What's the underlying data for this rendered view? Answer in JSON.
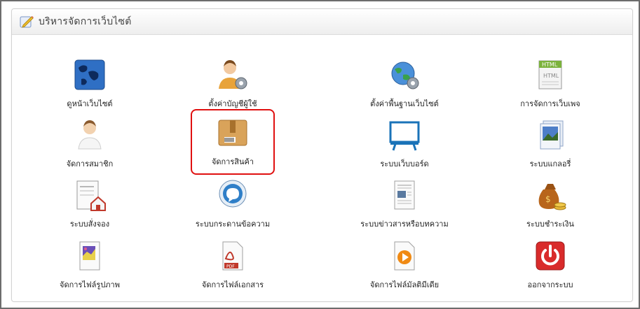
{
  "panel": {
    "title": "บริหารจัดการเว็บไซต์"
  },
  "tiles": [
    {
      "label": "ดูหน้าเว็บไซต์",
      "icon": "globe-icon"
    },
    {
      "label": "ตั้งค่าบัญชีผู้ใช้",
      "icon": "user-settings-icon"
    },
    {
      "label": "ตั้งค่าพื้นฐานเว็บไซต์",
      "icon": "web-settings-icon"
    },
    {
      "label": "การจัดการเว็บเพจ",
      "icon": "html-page-icon"
    },
    {
      "label": "จัดการสมาชิก",
      "icon": "member-icon"
    },
    {
      "label": "จัดการสินค้า",
      "icon": "product-box-icon"
    },
    {
      "label": "ระบบเว็บบอร์ด",
      "icon": "webboard-icon"
    },
    {
      "label": "ระบบแกลอรี่",
      "icon": "gallery-icon"
    },
    {
      "label": "ระบบสั่งจอง",
      "icon": "booking-icon"
    },
    {
      "label": "ระบบกระดานข้อความ",
      "icon": "chat-bubble-icon"
    },
    {
      "label": "ระบบข่าวสารหรือบทความ",
      "icon": "news-article-icon"
    },
    {
      "label": "ระบบชำระเงิน",
      "icon": "money-bag-icon"
    },
    {
      "label": "จัดการไฟล์รูปภาพ",
      "icon": "image-file-icon"
    },
    {
      "label": "จัดการไฟล์เอกสาร",
      "icon": "pdf-file-icon"
    },
    {
      "label": "จัดการไฟล์มัลติมีเดีย",
      "icon": "media-file-icon"
    },
    {
      "label": "ออกจากระบบ",
      "icon": "power-icon"
    }
  ],
  "colors": {
    "highlight": "#e01010",
    "frame": "#6d6d6d"
  }
}
